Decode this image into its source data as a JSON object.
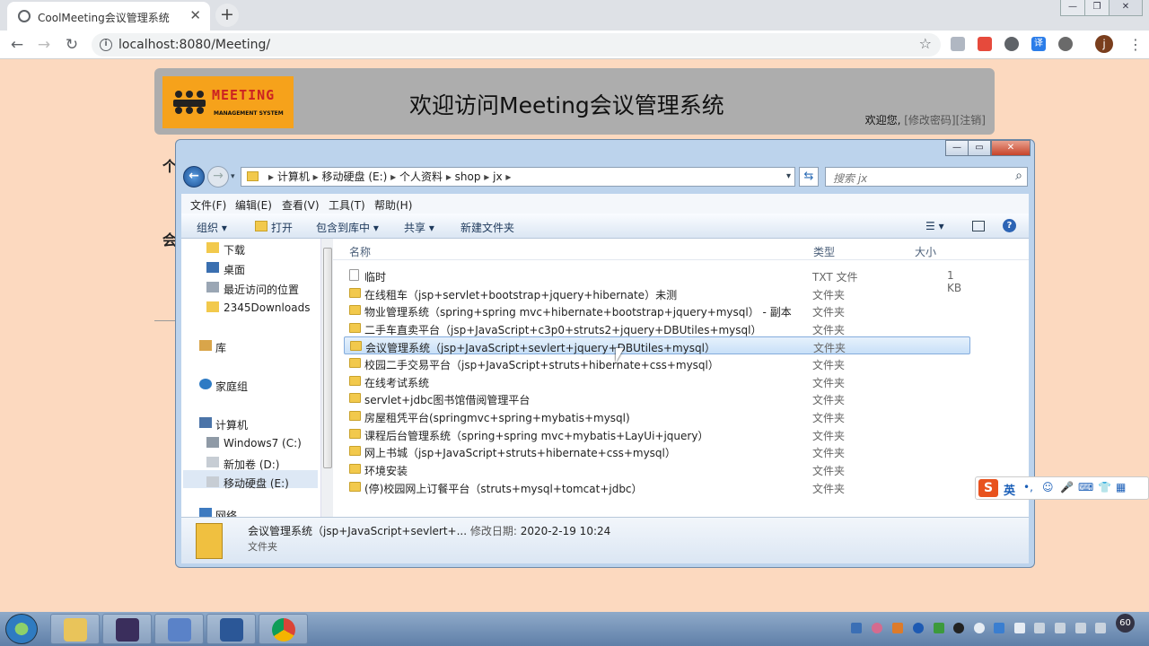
{
  "browser": {
    "tab_title": "CoolMeeting会议管理系统",
    "url": "localhost:8080/Meeting/",
    "profile_initial": "j",
    "translate_badge": "译"
  },
  "page": {
    "logo_main": "MEETING",
    "logo_sub": "MANAGEMENT SYSTEM",
    "title": "欢迎访问Meeting会议管理系统",
    "welcome": "欢迎您,",
    "change_pwd": "[修改密码]",
    "logout": "[注销]",
    "side_heading_1": "个",
    "side_heading_2": "会"
  },
  "explorer": {
    "breadcrumbs": [
      "计算机",
      "移动硬盘 (E:)",
      "个人资料",
      "shop",
      "jx"
    ],
    "search_placeholder": "搜索 jx",
    "menu": [
      "文件(F)",
      "编辑(E)",
      "查看(V)",
      "工具(T)",
      "帮助(H)"
    ],
    "commands": {
      "organize": "组织 ▾",
      "open": "打开",
      "include": "包含到库中 ▾",
      "share": "共享 ▾",
      "new_folder": "新建文件夹"
    },
    "nav": {
      "downloads": "下载",
      "desktop": "桌面",
      "recent": "最近访问的位置",
      "downloads2345": "2345Downloads",
      "libraries": "库",
      "homegroup": "家庭组",
      "computer": "计算机",
      "drive_c": "Windows7 (C:)",
      "drive_d": "新加卷 (D:)",
      "drive_e": "移动硬盘 (E:)",
      "network": "网络"
    },
    "columns": {
      "name": "名称",
      "type": "类型",
      "size": "大小"
    },
    "files": [
      {
        "name": "临时",
        "type": "TXT 文件",
        "size": "1 KB"
      },
      {
        "name": "在线租车（jsp+servlet+bootstrap+jquery+hibernate）未测",
        "type": "文件夹",
        "size": ""
      },
      {
        "name": "物业管理系统（spring+spring mvc+hibernate+bootstrap+jquery+mysql） - 副本",
        "type": "文件夹",
        "size": ""
      },
      {
        "name": "二手车直卖平台（jsp+JavaScript+c3p0+struts2+jquery+DBUtiles+mysql）",
        "type": "文件夹",
        "size": ""
      },
      {
        "name": "会议管理系统（jsp+JavaScript+sevlert+jquery+DBUtiles+mysql）",
        "type": "文件夹",
        "size": ""
      },
      {
        "name": "校园二手交易平台（jsp+JavaScript+struts+hibernate+css+mysql）",
        "type": "文件夹",
        "size": ""
      },
      {
        "name": "在线考试系统",
        "type": "文件夹",
        "size": ""
      },
      {
        "name": "servlet+jdbc图书馆借阅管理平台",
        "type": "文件夹",
        "size": ""
      },
      {
        "name": "房屋租凭平台(springmvc+spring+mybatis+mysql)",
        "type": "文件夹",
        "size": ""
      },
      {
        "name": "课程后台管理系统（spring+spring mvc+mybatis+LayUi+jquery）",
        "type": "文件夹",
        "size": ""
      },
      {
        "name": "网上书城（jsp+JavaScript+struts+hibernate+css+mysql）",
        "type": "文件夹",
        "size": ""
      },
      {
        "name": "环境安装",
        "type": "文件夹",
        "size": ""
      },
      {
        "name": "(停)校园网上订餐平台（struts+mysql+tomcat+jdbc）",
        "type": "文件夹",
        "size": ""
      }
    ],
    "details": {
      "name": "会议管理系统（jsp+JavaScript+sevlert+...",
      "modified_label": "修改日期:",
      "modified": "2020-2-19 10:24",
      "type": "文件夹"
    }
  },
  "ime": {
    "logo": "S",
    "lang": "英",
    "punct": "•,",
    "emoji": "☺",
    "voice": "🎤",
    "keyboard": "⌨",
    "skin": "👕",
    "tools": "▦"
  },
  "taskbar": {
    "clock": "60"
  }
}
